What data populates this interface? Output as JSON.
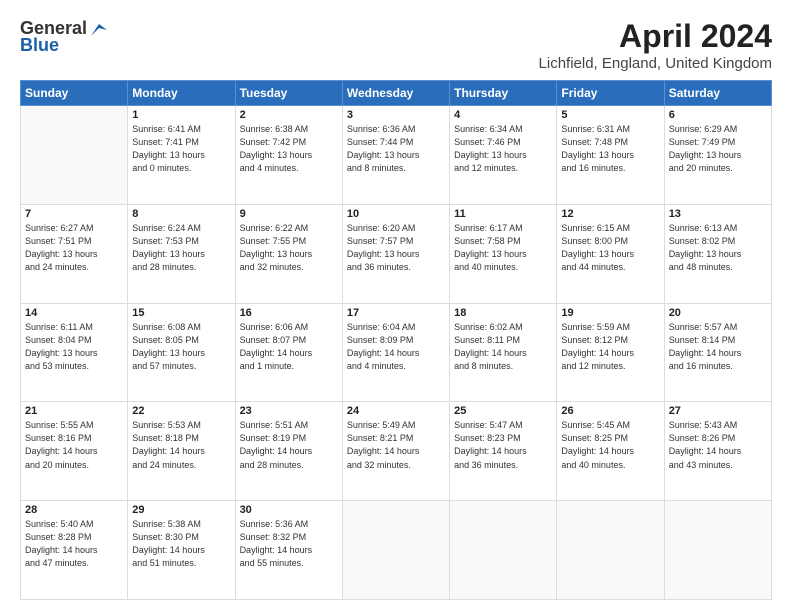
{
  "header": {
    "logo_line1": "General",
    "logo_line2": "Blue",
    "title": "April 2024",
    "subtitle": "Lichfield, England, United Kingdom"
  },
  "weekdays": [
    "Sunday",
    "Monday",
    "Tuesday",
    "Wednesday",
    "Thursday",
    "Friday",
    "Saturday"
  ],
  "rows": [
    [
      {
        "num": "",
        "info": ""
      },
      {
        "num": "1",
        "info": "Sunrise: 6:41 AM\nSunset: 7:41 PM\nDaylight: 13 hours\nand 0 minutes."
      },
      {
        "num": "2",
        "info": "Sunrise: 6:38 AM\nSunset: 7:42 PM\nDaylight: 13 hours\nand 4 minutes."
      },
      {
        "num": "3",
        "info": "Sunrise: 6:36 AM\nSunset: 7:44 PM\nDaylight: 13 hours\nand 8 minutes."
      },
      {
        "num": "4",
        "info": "Sunrise: 6:34 AM\nSunset: 7:46 PM\nDaylight: 13 hours\nand 12 minutes."
      },
      {
        "num": "5",
        "info": "Sunrise: 6:31 AM\nSunset: 7:48 PM\nDaylight: 13 hours\nand 16 minutes."
      },
      {
        "num": "6",
        "info": "Sunrise: 6:29 AM\nSunset: 7:49 PM\nDaylight: 13 hours\nand 20 minutes."
      }
    ],
    [
      {
        "num": "7",
        "info": "Sunrise: 6:27 AM\nSunset: 7:51 PM\nDaylight: 13 hours\nand 24 minutes."
      },
      {
        "num": "8",
        "info": "Sunrise: 6:24 AM\nSunset: 7:53 PM\nDaylight: 13 hours\nand 28 minutes."
      },
      {
        "num": "9",
        "info": "Sunrise: 6:22 AM\nSunset: 7:55 PM\nDaylight: 13 hours\nand 32 minutes."
      },
      {
        "num": "10",
        "info": "Sunrise: 6:20 AM\nSunset: 7:57 PM\nDaylight: 13 hours\nand 36 minutes."
      },
      {
        "num": "11",
        "info": "Sunrise: 6:17 AM\nSunset: 7:58 PM\nDaylight: 13 hours\nand 40 minutes."
      },
      {
        "num": "12",
        "info": "Sunrise: 6:15 AM\nSunset: 8:00 PM\nDaylight: 13 hours\nand 44 minutes."
      },
      {
        "num": "13",
        "info": "Sunrise: 6:13 AM\nSunset: 8:02 PM\nDaylight: 13 hours\nand 48 minutes."
      }
    ],
    [
      {
        "num": "14",
        "info": "Sunrise: 6:11 AM\nSunset: 8:04 PM\nDaylight: 13 hours\nand 53 minutes."
      },
      {
        "num": "15",
        "info": "Sunrise: 6:08 AM\nSunset: 8:05 PM\nDaylight: 13 hours\nand 57 minutes."
      },
      {
        "num": "16",
        "info": "Sunrise: 6:06 AM\nSunset: 8:07 PM\nDaylight: 14 hours\nand 1 minute."
      },
      {
        "num": "17",
        "info": "Sunrise: 6:04 AM\nSunset: 8:09 PM\nDaylight: 14 hours\nand 4 minutes."
      },
      {
        "num": "18",
        "info": "Sunrise: 6:02 AM\nSunset: 8:11 PM\nDaylight: 14 hours\nand 8 minutes."
      },
      {
        "num": "19",
        "info": "Sunrise: 5:59 AM\nSunset: 8:12 PM\nDaylight: 14 hours\nand 12 minutes."
      },
      {
        "num": "20",
        "info": "Sunrise: 5:57 AM\nSunset: 8:14 PM\nDaylight: 14 hours\nand 16 minutes."
      }
    ],
    [
      {
        "num": "21",
        "info": "Sunrise: 5:55 AM\nSunset: 8:16 PM\nDaylight: 14 hours\nand 20 minutes."
      },
      {
        "num": "22",
        "info": "Sunrise: 5:53 AM\nSunset: 8:18 PM\nDaylight: 14 hours\nand 24 minutes."
      },
      {
        "num": "23",
        "info": "Sunrise: 5:51 AM\nSunset: 8:19 PM\nDaylight: 14 hours\nand 28 minutes."
      },
      {
        "num": "24",
        "info": "Sunrise: 5:49 AM\nSunset: 8:21 PM\nDaylight: 14 hours\nand 32 minutes."
      },
      {
        "num": "25",
        "info": "Sunrise: 5:47 AM\nSunset: 8:23 PM\nDaylight: 14 hours\nand 36 minutes."
      },
      {
        "num": "26",
        "info": "Sunrise: 5:45 AM\nSunset: 8:25 PM\nDaylight: 14 hours\nand 40 minutes."
      },
      {
        "num": "27",
        "info": "Sunrise: 5:43 AM\nSunset: 8:26 PM\nDaylight: 14 hours\nand 43 minutes."
      }
    ],
    [
      {
        "num": "28",
        "info": "Sunrise: 5:40 AM\nSunset: 8:28 PM\nDaylight: 14 hours\nand 47 minutes."
      },
      {
        "num": "29",
        "info": "Sunrise: 5:38 AM\nSunset: 8:30 PM\nDaylight: 14 hours\nand 51 minutes."
      },
      {
        "num": "30",
        "info": "Sunrise: 5:36 AM\nSunset: 8:32 PM\nDaylight: 14 hours\nand 55 minutes."
      },
      {
        "num": "",
        "info": ""
      },
      {
        "num": "",
        "info": ""
      },
      {
        "num": "",
        "info": ""
      },
      {
        "num": "",
        "info": ""
      }
    ]
  ]
}
